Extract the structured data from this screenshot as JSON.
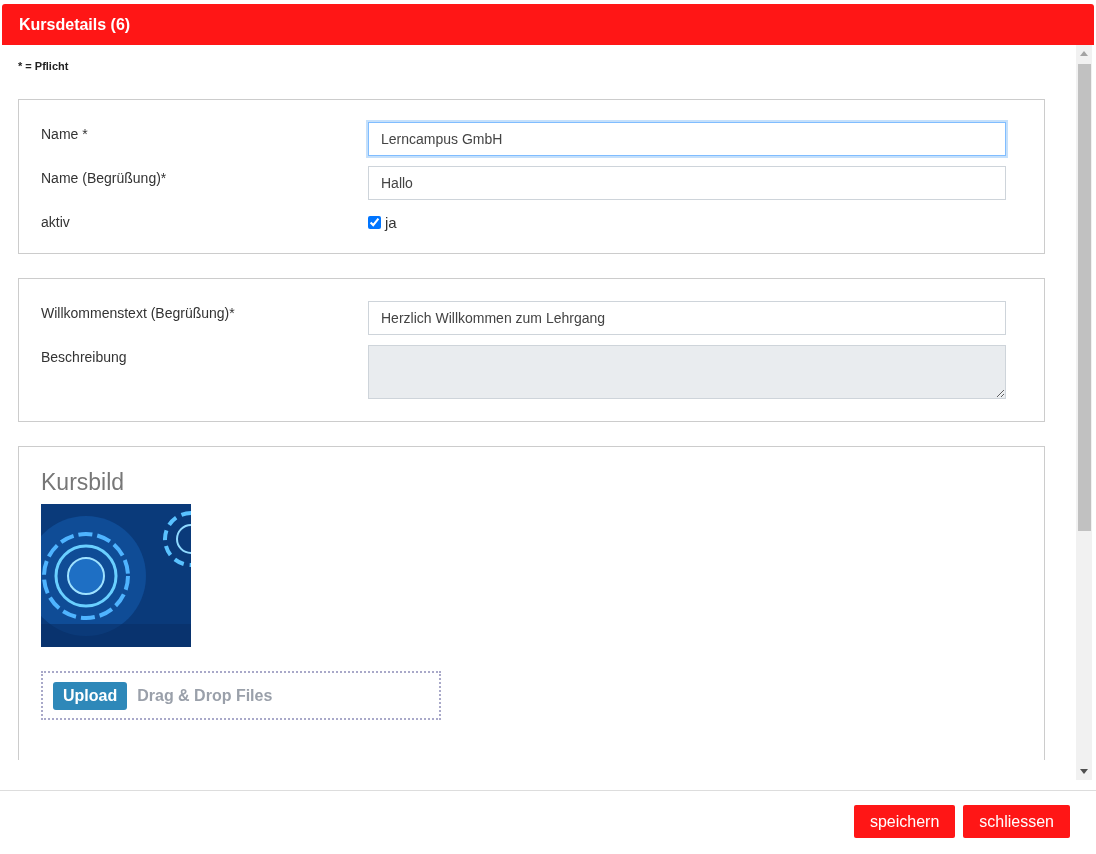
{
  "dialog": {
    "title": "Kursdetails (6)"
  },
  "required_note": "* = Pflicht",
  "sections": [
    {
      "fields": [
        {
          "kind": "text",
          "label": "Name *",
          "value": "Lerncampus GmbH",
          "focused": true
        },
        {
          "kind": "text",
          "label": "Name (Begrüßung)*",
          "value": "Hallo",
          "focused": false
        },
        {
          "kind": "checkbox",
          "label": "aktiv",
          "option": "ja",
          "checked": true
        }
      ]
    },
    {
      "fields": [
        {
          "kind": "text",
          "label": "Willkommenstext (Begrüßung)*",
          "value": "Herzlich Willkommen zum Lehrgang",
          "focused": false
        },
        {
          "kind": "textarea",
          "label": "Beschreibung",
          "disabled": true
        }
      ]
    }
  ],
  "image_section": {
    "title": "Kursbild",
    "upload": {
      "button": "Upload",
      "hint": "Drag & Drop Files"
    }
  },
  "buttons": [
    "speichern",
    "schliessen"
  ]
}
